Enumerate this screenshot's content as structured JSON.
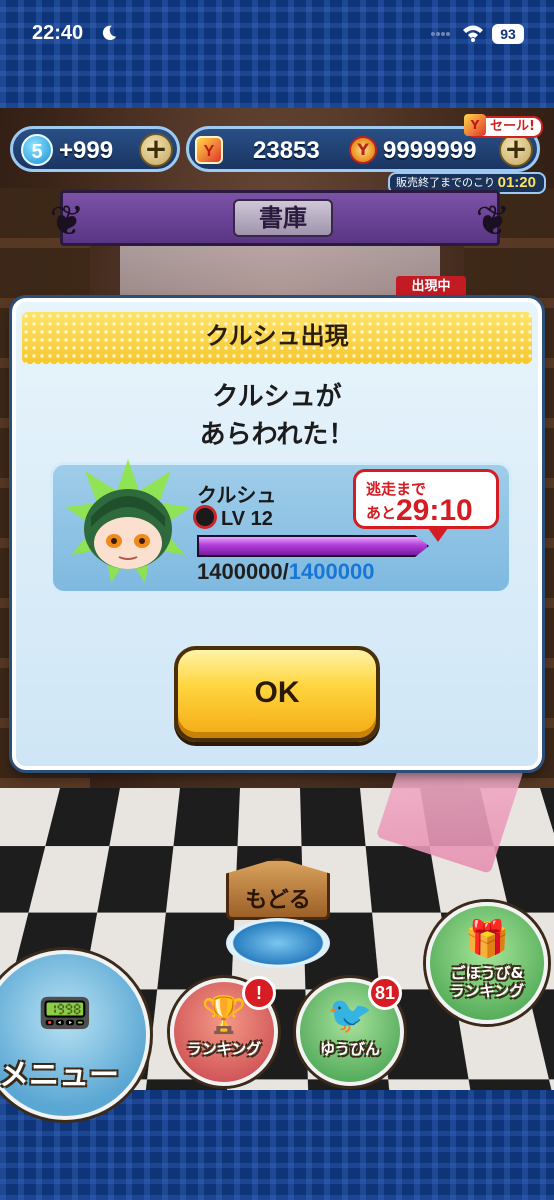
{
  "status_bar": {
    "time": "22:40",
    "battery": "93"
  },
  "hud": {
    "spirit_level": "5",
    "spirit_value": "+999",
    "ymoney_value": "23853",
    "coin_value": "9999999",
    "sale_label": "セール!",
    "sale_timer_label": "販売終了までのこり",
    "sale_timer_value": "01:20"
  },
  "location": {
    "name": "書庫"
  },
  "background_tag": "出現中",
  "dialog": {
    "title": "クルシュ出現",
    "message": "クルシュが\nあらわれた！",
    "enemy": {
      "name": "クルシュ",
      "level": "LV 12",
      "hp_current": "1400000",
      "hp_separator": "/",
      "hp_max": "1400000",
      "hp_fraction": 1.0
    },
    "flee": {
      "label_top": "逃走まで",
      "label_bottom": "あと",
      "time": "29:10"
    },
    "ok_label": "OK"
  },
  "bottom": {
    "back_label": "もどる",
    "menu_label": "メニュー",
    "ranking_label": "ランキング",
    "ranking_badge": "!",
    "mail_label": "ゆうびん",
    "mail_badge": "81",
    "reward_label": "ごほうび&\nランキング"
  },
  "colors": {
    "frame": "#0e3479",
    "dialog_header": "#f6c72f",
    "ok_button": "#ffd640",
    "flee_red": "#d51c23",
    "hp_max_blue": "#1a76d6"
  }
}
